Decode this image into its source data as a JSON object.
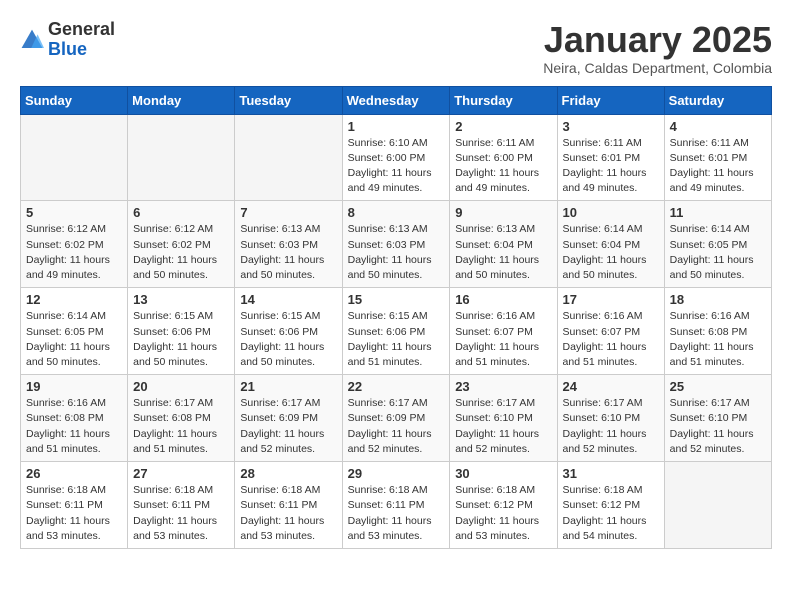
{
  "logo": {
    "general": "General",
    "blue": "Blue"
  },
  "header": {
    "month": "January 2025",
    "location": "Neira, Caldas Department, Colombia"
  },
  "weekdays": [
    "Sunday",
    "Monday",
    "Tuesday",
    "Wednesday",
    "Thursday",
    "Friday",
    "Saturday"
  ],
  "weeks": [
    [
      {
        "day": "",
        "info": ""
      },
      {
        "day": "",
        "info": ""
      },
      {
        "day": "",
        "info": ""
      },
      {
        "day": "1",
        "info": "Sunrise: 6:10 AM\nSunset: 6:00 PM\nDaylight: 11 hours\nand 49 minutes."
      },
      {
        "day": "2",
        "info": "Sunrise: 6:11 AM\nSunset: 6:00 PM\nDaylight: 11 hours\nand 49 minutes."
      },
      {
        "day": "3",
        "info": "Sunrise: 6:11 AM\nSunset: 6:01 PM\nDaylight: 11 hours\nand 49 minutes."
      },
      {
        "day": "4",
        "info": "Sunrise: 6:11 AM\nSunset: 6:01 PM\nDaylight: 11 hours\nand 49 minutes."
      }
    ],
    [
      {
        "day": "5",
        "info": "Sunrise: 6:12 AM\nSunset: 6:02 PM\nDaylight: 11 hours\nand 49 minutes."
      },
      {
        "day": "6",
        "info": "Sunrise: 6:12 AM\nSunset: 6:02 PM\nDaylight: 11 hours\nand 50 minutes."
      },
      {
        "day": "7",
        "info": "Sunrise: 6:13 AM\nSunset: 6:03 PM\nDaylight: 11 hours\nand 50 minutes."
      },
      {
        "day": "8",
        "info": "Sunrise: 6:13 AM\nSunset: 6:03 PM\nDaylight: 11 hours\nand 50 minutes."
      },
      {
        "day": "9",
        "info": "Sunrise: 6:13 AM\nSunset: 6:04 PM\nDaylight: 11 hours\nand 50 minutes."
      },
      {
        "day": "10",
        "info": "Sunrise: 6:14 AM\nSunset: 6:04 PM\nDaylight: 11 hours\nand 50 minutes."
      },
      {
        "day": "11",
        "info": "Sunrise: 6:14 AM\nSunset: 6:05 PM\nDaylight: 11 hours\nand 50 minutes."
      }
    ],
    [
      {
        "day": "12",
        "info": "Sunrise: 6:14 AM\nSunset: 6:05 PM\nDaylight: 11 hours\nand 50 minutes."
      },
      {
        "day": "13",
        "info": "Sunrise: 6:15 AM\nSunset: 6:06 PM\nDaylight: 11 hours\nand 50 minutes."
      },
      {
        "day": "14",
        "info": "Sunrise: 6:15 AM\nSunset: 6:06 PM\nDaylight: 11 hours\nand 50 minutes."
      },
      {
        "day": "15",
        "info": "Sunrise: 6:15 AM\nSunset: 6:06 PM\nDaylight: 11 hours\nand 51 minutes."
      },
      {
        "day": "16",
        "info": "Sunrise: 6:16 AM\nSunset: 6:07 PM\nDaylight: 11 hours\nand 51 minutes."
      },
      {
        "day": "17",
        "info": "Sunrise: 6:16 AM\nSunset: 6:07 PM\nDaylight: 11 hours\nand 51 minutes."
      },
      {
        "day": "18",
        "info": "Sunrise: 6:16 AM\nSunset: 6:08 PM\nDaylight: 11 hours\nand 51 minutes."
      }
    ],
    [
      {
        "day": "19",
        "info": "Sunrise: 6:16 AM\nSunset: 6:08 PM\nDaylight: 11 hours\nand 51 minutes."
      },
      {
        "day": "20",
        "info": "Sunrise: 6:17 AM\nSunset: 6:08 PM\nDaylight: 11 hours\nand 51 minutes."
      },
      {
        "day": "21",
        "info": "Sunrise: 6:17 AM\nSunset: 6:09 PM\nDaylight: 11 hours\nand 52 minutes."
      },
      {
        "day": "22",
        "info": "Sunrise: 6:17 AM\nSunset: 6:09 PM\nDaylight: 11 hours\nand 52 minutes."
      },
      {
        "day": "23",
        "info": "Sunrise: 6:17 AM\nSunset: 6:10 PM\nDaylight: 11 hours\nand 52 minutes."
      },
      {
        "day": "24",
        "info": "Sunrise: 6:17 AM\nSunset: 6:10 PM\nDaylight: 11 hours\nand 52 minutes."
      },
      {
        "day": "25",
        "info": "Sunrise: 6:17 AM\nSunset: 6:10 PM\nDaylight: 11 hours\nand 52 minutes."
      }
    ],
    [
      {
        "day": "26",
        "info": "Sunrise: 6:18 AM\nSunset: 6:11 PM\nDaylight: 11 hours\nand 53 minutes."
      },
      {
        "day": "27",
        "info": "Sunrise: 6:18 AM\nSunset: 6:11 PM\nDaylight: 11 hours\nand 53 minutes."
      },
      {
        "day": "28",
        "info": "Sunrise: 6:18 AM\nSunset: 6:11 PM\nDaylight: 11 hours\nand 53 minutes."
      },
      {
        "day": "29",
        "info": "Sunrise: 6:18 AM\nSunset: 6:11 PM\nDaylight: 11 hours\nand 53 minutes."
      },
      {
        "day": "30",
        "info": "Sunrise: 6:18 AM\nSunset: 6:12 PM\nDaylight: 11 hours\nand 53 minutes."
      },
      {
        "day": "31",
        "info": "Sunrise: 6:18 AM\nSunset: 6:12 PM\nDaylight: 11 hours\nand 54 minutes."
      },
      {
        "day": "",
        "info": ""
      }
    ]
  ]
}
